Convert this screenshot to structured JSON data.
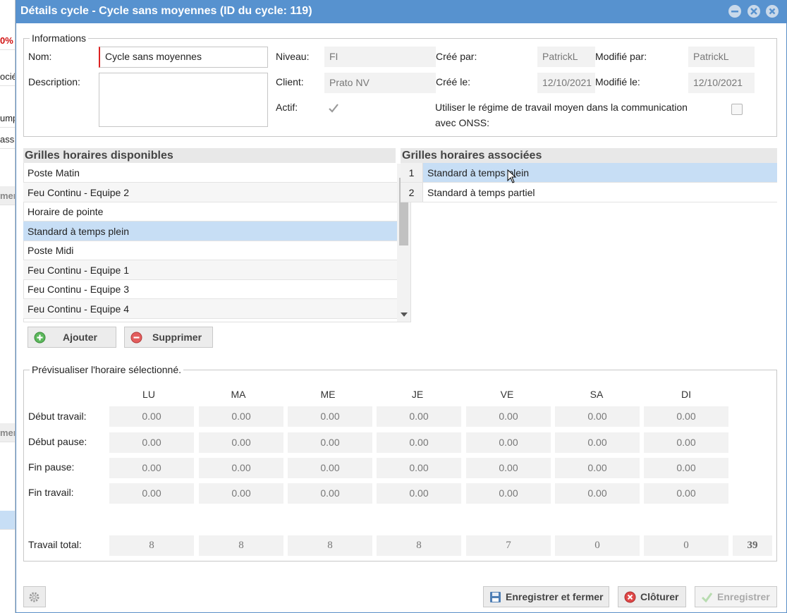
{
  "background": {
    "cells": [
      "0%",
      "ocié",
      "ump",
      "ass",
      "mer",
      "mer"
    ]
  },
  "window": {
    "title": "Détails cycle - Cycle sans moyennes (ID du cycle: 119)"
  },
  "informations": {
    "legend": "Informations",
    "nom_label": "Nom:",
    "nom_value": "Cycle sans moyennes",
    "description_label": "Description:",
    "description_value": "",
    "niveau_label": "Niveau:",
    "niveau_value": "FI",
    "client_label": "Client:",
    "client_value": "Prato NV",
    "actif_label": "Actif:",
    "actif_checked": true,
    "cree_par_label": "Créé par:",
    "cree_par_value": "PatrickL",
    "cree_le_label": "Créé le:",
    "cree_le_value": "12/10/2021",
    "modifie_par_label": "Modifié par:",
    "modifie_par_value": "PatrickL",
    "modifie_le_label": "Modifié le:",
    "modifie_le_value": "12/10/2021",
    "onss_label_line1": "Utiliser le régime de travail moyen dans la communication",
    "onss_label_line2": "avec ONSS:",
    "onss_checked": false
  },
  "available": {
    "title": "Grilles horaires disponibles",
    "items": [
      "Poste Matin",
      "Feu Continu - Equipe 2",
      "Horaire de pointe",
      "Standard à temps plein",
      "Poste Midi",
      "Feu Continu - Equipe 1",
      "Feu Continu - Equipe 3",
      "Feu Continu - Equipe 4"
    ],
    "selected": "Standard à temps plein"
  },
  "associated": {
    "title": "Grilles horaires associées",
    "items": [
      {
        "num": "1",
        "name": "Standard à temps plein"
      },
      {
        "num": "2",
        "name": "Standard à temps partiel"
      }
    ]
  },
  "actions": {
    "add_label": "Ajouter",
    "remove_label": "Supprimer"
  },
  "preview": {
    "legend": "Prévisualiser l'horaire sélectionné.",
    "days": [
      "LU",
      "MA",
      "ME",
      "JE",
      "VE",
      "SA",
      "DI"
    ],
    "rows": [
      {
        "label": "Début travail:",
        "values": [
          "0.00",
          "0.00",
          "0.00",
          "0.00",
          "0.00",
          "0.00",
          "0.00"
        ]
      },
      {
        "label": "Début pause:",
        "values": [
          "0.00",
          "0.00",
          "0.00",
          "0.00",
          "0.00",
          "0.00",
          "0.00"
        ]
      },
      {
        "label": "Fin pause:",
        "values": [
          "0.00",
          "0.00",
          "0.00",
          "0.00",
          "0.00",
          "0.00",
          "0.00"
        ]
      },
      {
        "label": "Fin travail:",
        "values": [
          "0.00",
          "0.00",
          "0.00",
          "0.00",
          "0.00",
          "0.00",
          "0.00"
        ]
      }
    ],
    "total_label": "Travail total:",
    "totals": [
      "8",
      "8",
      "8",
      "8",
      "7",
      "0",
      "0"
    ],
    "grand_total": "39"
  },
  "footer": {
    "save_close_label": "Enregistrer et fermer",
    "close_label": "Clôturer",
    "save_label": "Enregistrer"
  },
  "colors": {
    "titlebar": "#5792cf",
    "selection": "#c7def5",
    "required_marker": "#d22222"
  }
}
